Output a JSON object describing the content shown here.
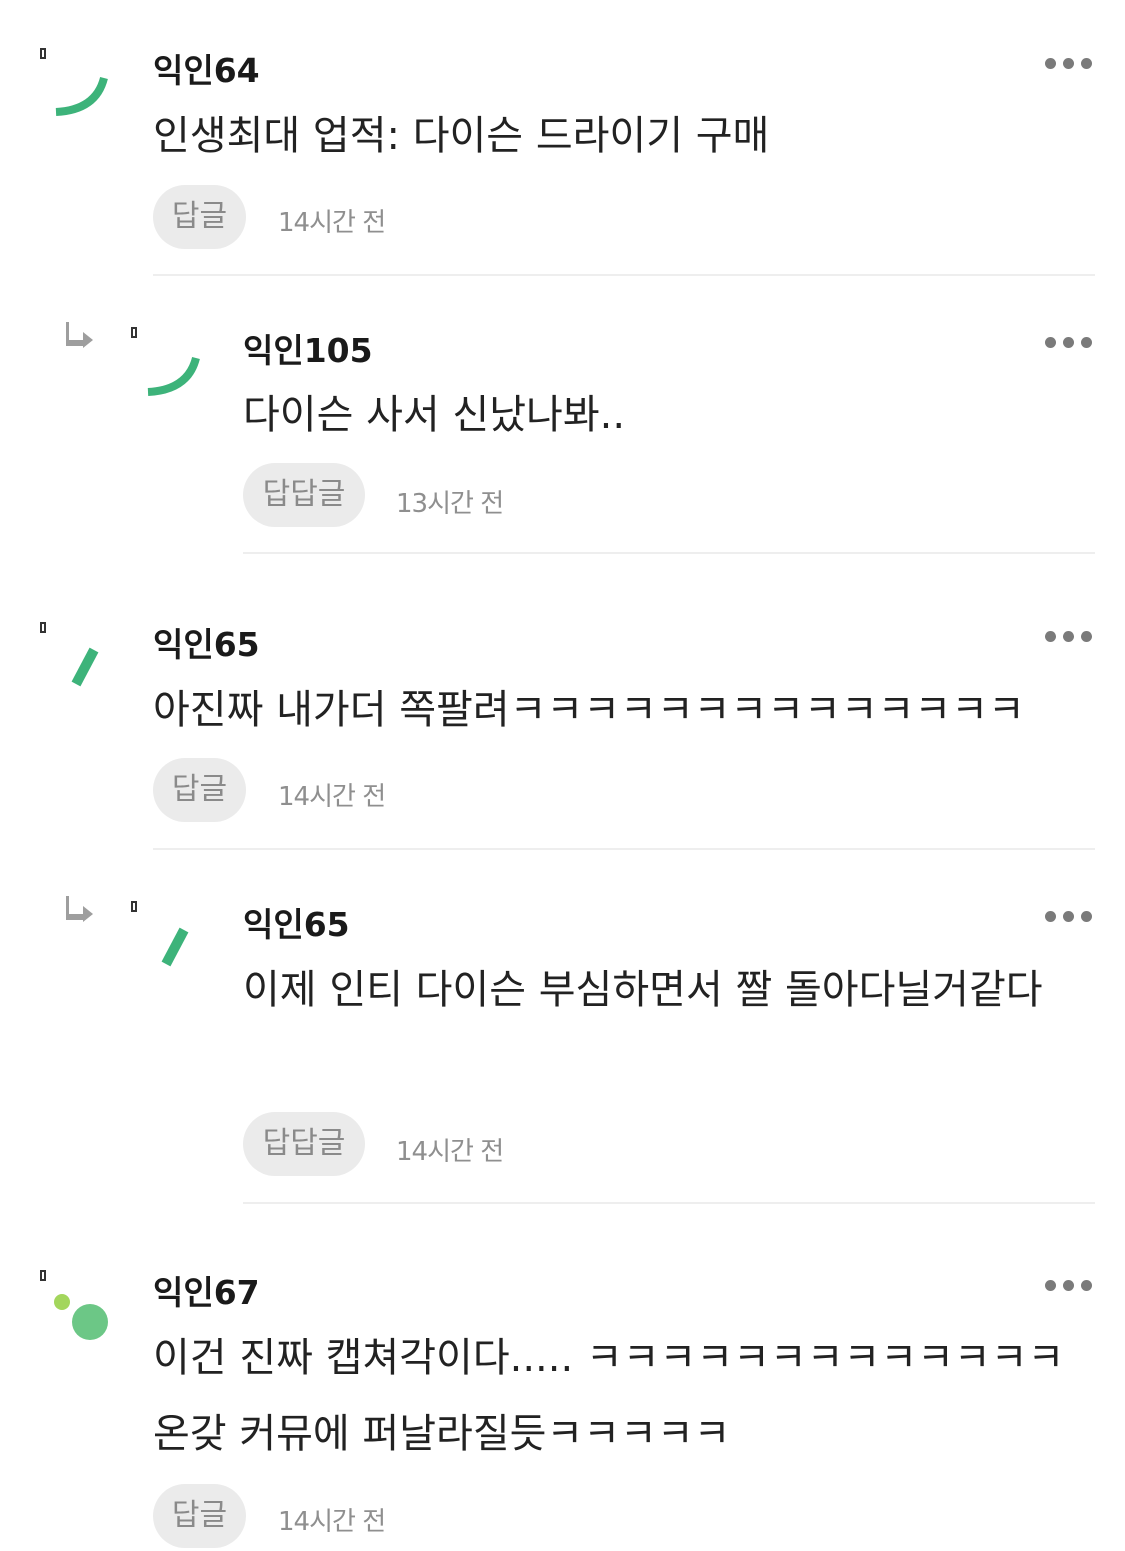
{
  "comments": [
    {
      "author": "익인64",
      "text": "인생최대 업적: 다이슨 드라이기 구매",
      "reply_label": "답글",
      "time": "14시간 전",
      "is_reply": false,
      "avatar_icon": "green-arc-icon"
    },
    {
      "author": "익인105",
      "text": "다이슨 사서 신났나봐..",
      "reply_label": "답답글",
      "time": "13시간 전",
      "is_reply": true,
      "avatar_icon": "green-arc-icon"
    },
    {
      "author": "익인65",
      "text": "아진짜 내가더 쪽팔려ㅋㅋㅋㅋㅋㅋㅋㅋㅋㅋㅋㅋㅋㅋ",
      "reply_label": "답글",
      "time": "14시간 전",
      "is_reply": false,
      "avatar_icon": "green-slash-icon"
    },
    {
      "author": "익인65",
      "text": "이제 인티 다이슨 부심하면서 짤 돌아다닐거같다",
      "reply_label": "답답글",
      "time": "14시간 전",
      "is_reply": true,
      "avatar_icon": "green-slash-icon"
    },
    {
      "author": "익인67",
      "text": "이건 진짜 캡쳐각이다..... ㅋㅋㅋㅋㅋㅋㅋㅋㅋㅋㅋㅋㅋ 온갖 커뮤에 퍼날라질듯ㅋㅋㅋㅋㅋ",
      "reply_label": "답글",
      "time": "14시간 전",
      "is_reply": false,
      "avatar_icon": "green-dots-icon"
    }
  ],
  "colors": {
    "avatar_green": "#3db37a",
    "avatar_green_light": "#6cc786",
    "avatar_lime": "#a3d65c",
    "reply_arrow": "#9e9e9e"
  }
}
